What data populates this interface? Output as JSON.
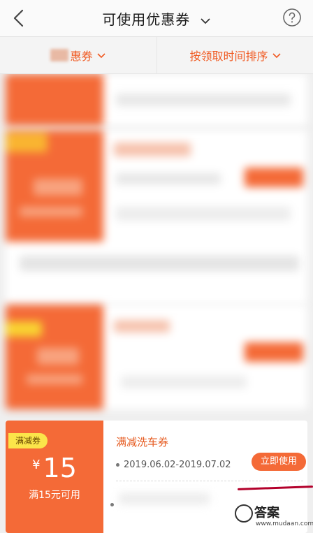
{
  "header": {
    "title": "可使用优惠券",
    "icons": [
      "back-chevron-icon",
      "chevron-down-icon",
      "help-circle-icon"
    ]
  },
  "filters": {
    "left_label": "惠券",
    "right_label": "按领取时间排序"
  },
  "coupon": {
    "tag": "满减券",
    "currency": "¥",
    "amount": "15",
    "condition": "满15元可用",
    "name": "满减洗车券",
    "validity": "2019.06.02-2019.07.02",
    "use_button": "立即使用"
  },
  "watermark": {
    "text": "答案",
    "url": "www.mudaan.com"
  },
  "colors": {
    "accent": "#f46a37",
    "accent_text": "#f05a22",
    "tag": "#fbe54a"
  }
}
